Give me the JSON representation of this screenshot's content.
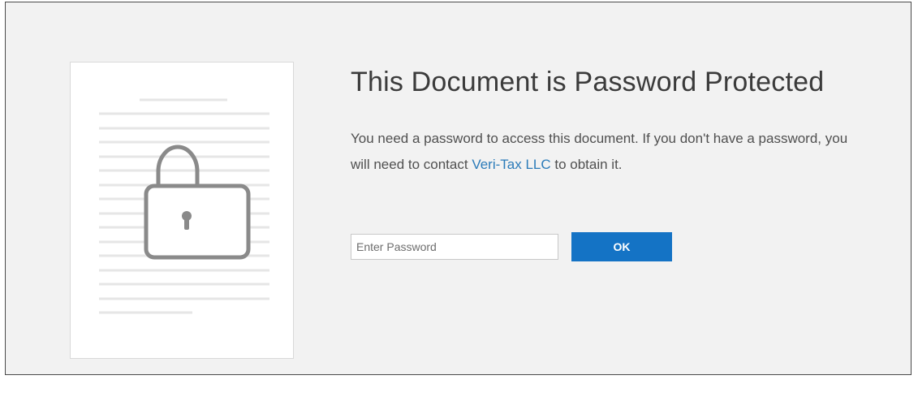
{
  "dialog": {
    "title": "This Document is Password Protected",
    "message_before_link": "You need a password to access this document. If you don't have a password, you will need to contact ",
    "link_text": "Veri-Tax LLC",
    "message_after_link": " to obtain it.",
    "password_placeholder": "Enter Password",
    "password_value": "",
    "ok_label": "OK"
  },
  "icons": {
    "document": "document-thumbnail-icon",
    "lock": "lock-icon"
  },
  "colors": {
    "background": "#f2f2f2",
    "accent": "#1473c5",
    "link": "#2b7bb9",
    "title": "#3b3b3b"
  }
}
